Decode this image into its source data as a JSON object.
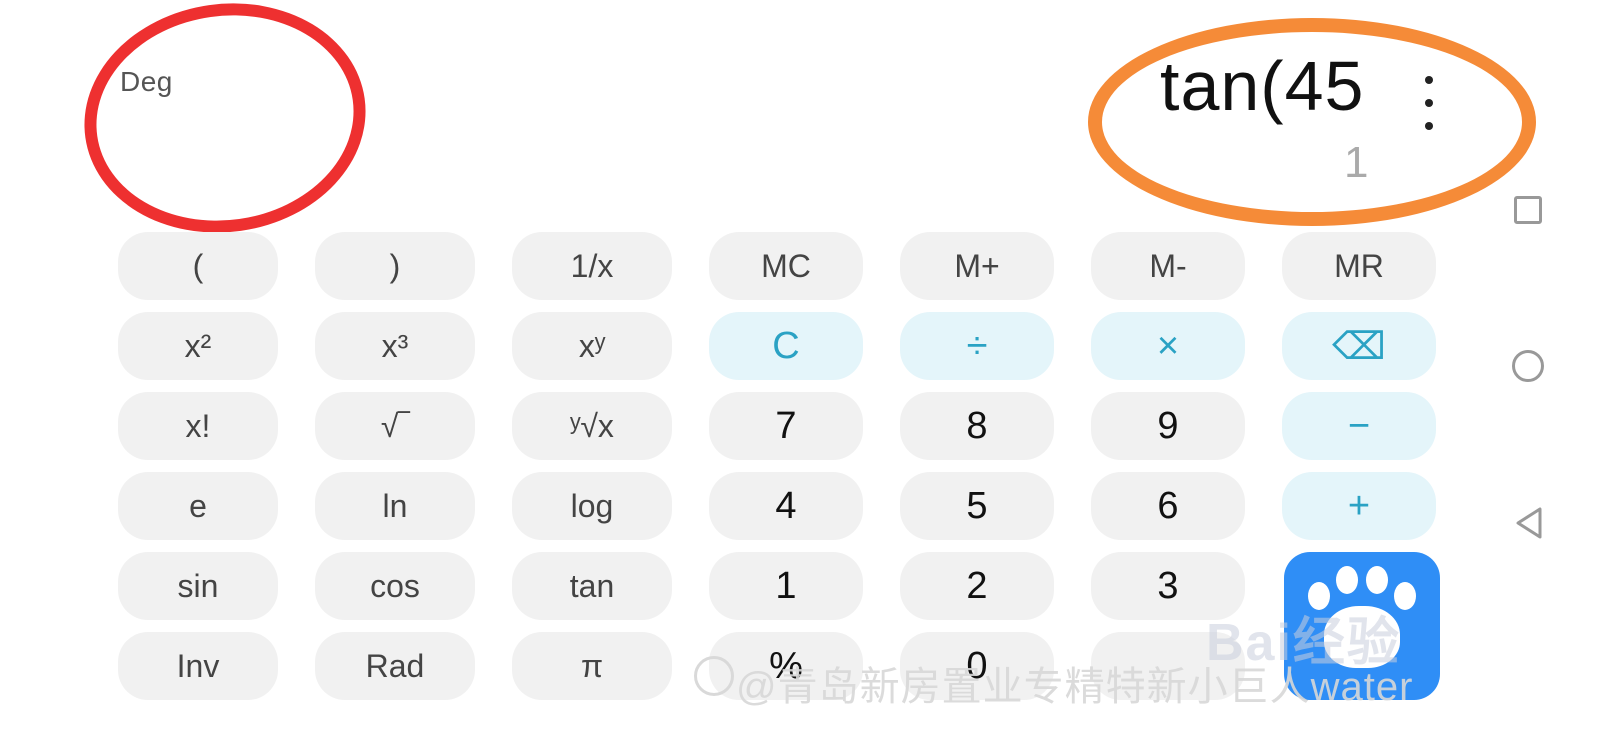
{
  "display": {
    "mode": "Deg",
    "expression": "tan(45",
    "result": "1"
  },
  "keypad": {
    "rows": [
      [
        {
          "label": "(",
          "kind": "sci"
        },
        {
          "label": ")",
          "kind": "sci"
        },
        {
          "label": "1/x",
          "kind": "sci"
        },
        {
          "label": "MC",
          "kind": "sci"
        },
        {
          "label": "M+",
          "kind": "sci"
        },
        {
          "label": "M-",
          "kind": "sci"
        },
        {
          "label": "MR",
          "kind": "sci"
        }
      ],
      [
        {
          "label": "x²",
          "kind": "sci"
        },
        {
          "label": "x³",
          "kind": "sci"
        },
        {
          "label": "xʸ",
          "kind": "sci"
        },
        {
          "label": "C",
          "kind": "op"
        },
        {
          "label": "÷",
          "kind": "op"
        },
        {
          "label": "×",
          "kind": "op"
        },
        {
          "label": "⌫",
          "kind": "op"
        }
      ],
      [
        {
          "label": "x!",
          "kind": "sci"
        },
        {
          "label": "√‾",
          "kind": "sci"
        },
        {
          "label": "ʸ√x",
          "kind": "sci"
        },
        {
          "label": "7",
          "kind": "num"
        },
        {
          "label": "8",
          "kind": "num"
        },
        {
          "label": "9",
          "kind": "num"
        },
        {
          "label": "−",
          "kind": "op"
        }
      ],
      [
        {
          "label": "e",
          "kind": "sci"
        },
        {
          "label": "ln",
          "kind": "sci"
        },
        {
          "label": "log",
          "kind": "sci"
        },
        {
          "label": "4",
          "kind": "num"
        },
        {
          "label": "5",
          "kind": "num"
        },
        {
          "label": "6",
          "kind": "num"
        },
        {
          "label": "+",
          "kind": "op"
        }
      ],
      [
        {
          "label": "sin",
          "kind": "sci"
        },
        {
          "label": "cos",
          "kind": "sci"
        },
        {
          "label": "tan",
          "kind": "sci"
        },
        {
          "label": "1",
          "kind": "num"
        },
        {
          "label": "2",
          "kind": "num"
        },
        {
          "label": "3",
          "kind": "num"
        },
        {
          "label": "",
          "kind": "hidden"
        }
      ],
      [
        {
          "label": "Inv",
          "kind": "sci"
        },
        {
          "label": "Rad",
          "kind": "sci"
        },
        {
          "label": "π",
          "kind": "sci"
        },
        {
          "label": "%",
          "kind": "num"
        },
        {
          "label": "0",
          "kind": "num"
        },
        {
          "label": "",
          "kind": "num"
        },
        {
          "label": "",
          "kind": "hidden"
        }
      ]
    ]
  },
  "watermarks": {
    "baidu": "Bai经验",
    "post": "@青岛新房置业专精特新小巨人water"
  },
  "colors": {
    "annotation_red": "#ee3030",
    "annotation_orange": "#f58b38",
    "operator_accent": "#2aa2c4",
    "baidu_blue": "#2f8ef6"
  },
  "icons": {
    "menu": "more-vert-icon",
    "nav_recent": "square-icon",
    "nav_home": "circle-icon",
    "nav_back": "triangle-back-icon"
  }
}
